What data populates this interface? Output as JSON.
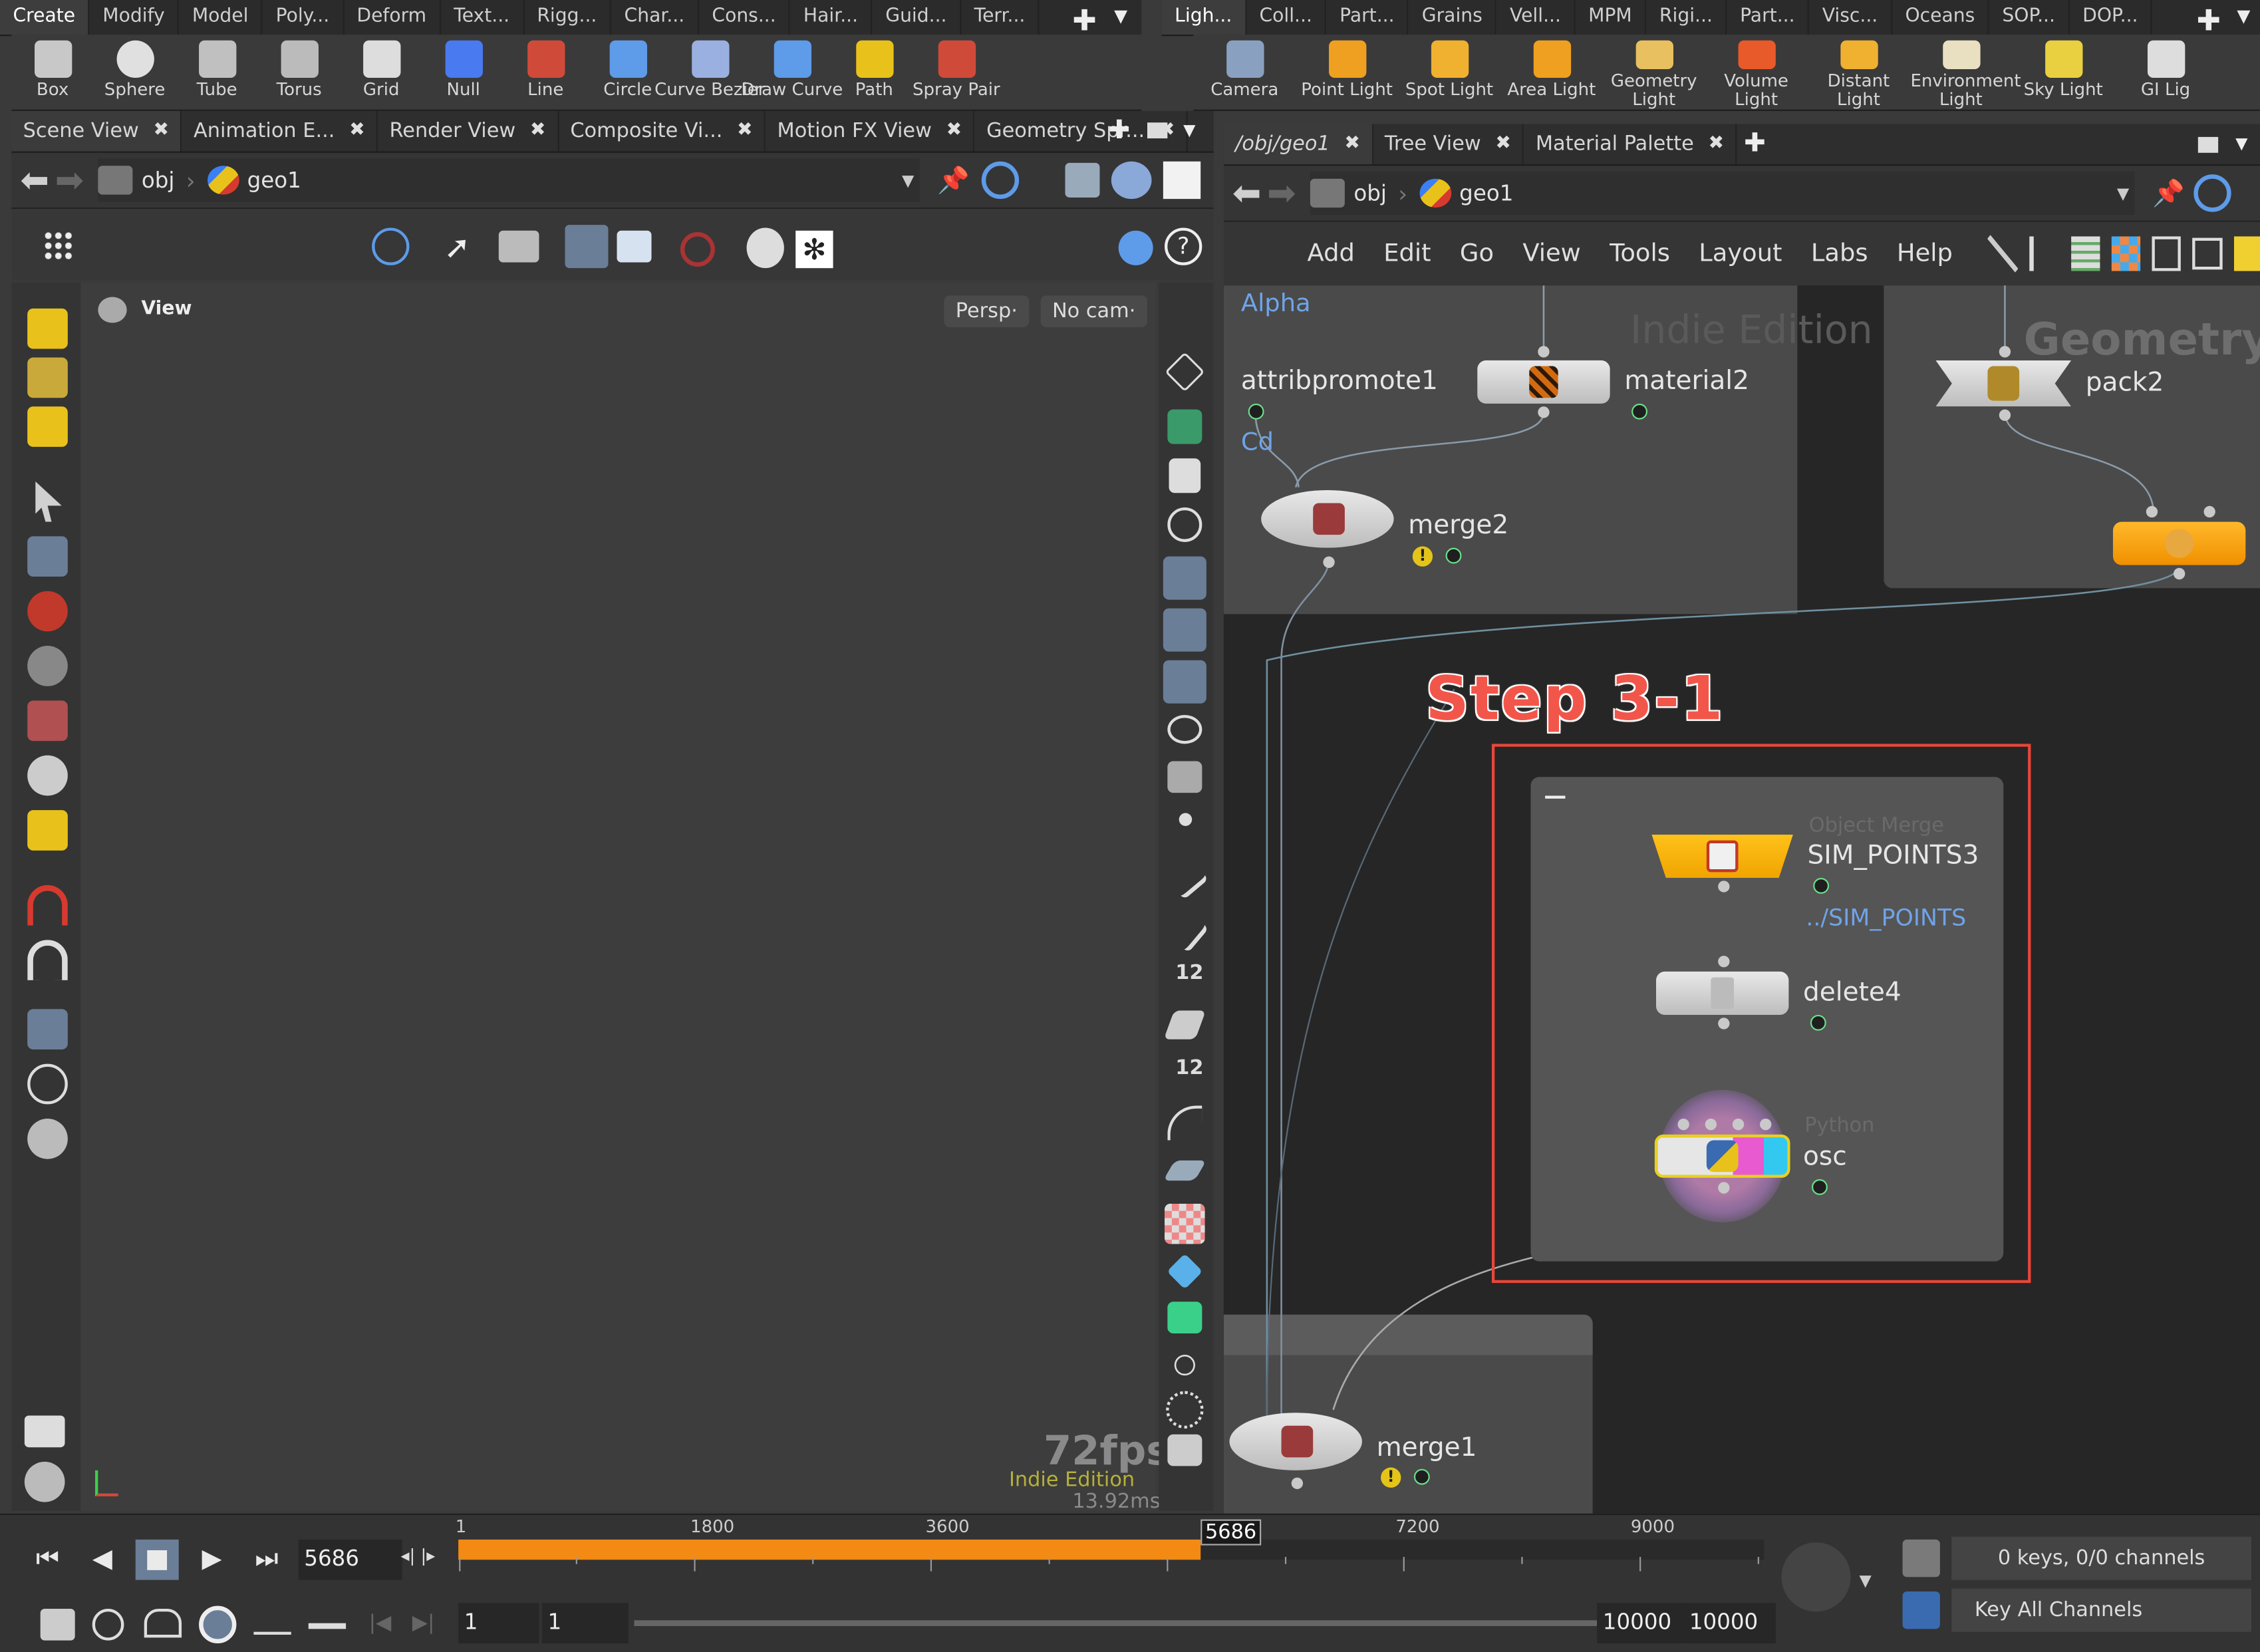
{
  "left_shelf": {
    "tabs": [
      "Create",
      "Modify",
      "Model",
      "Poly...",
      "Deform",
      "Text...",
      "Rigg...",
      "Char...",
      "Cons...",
      "Hair...",
      "Guid...",
      "Terr..."
    ],
    "tools": [
      {
        "label": "Box",
        "icon": "box-icon"
      },
      {
        "label": "Sphere",
        "icon": "sphere-icon"
      },
      {
        "label": "Tube",
        "icon": "tube-icon"
      },
      {
        "label": "Torus",
        "icon": "torus-icon"
      },
      {
        "label": "Grid",
        "icon": "grid-icon"
      },
      {
        "label": "Null",
        "icon": "null-icon"
      },
      {
        "label": "Line",
        "icon": "line-icon"
      },
      {
        "label": "Circle",
        "icon": "circle-icon"
      },
      {
        "label": "Curve Bezier",
        "icon": "curve-bezier-icon"
      },
      {
        "label": "Draw Curve",
        "icon": "draw-curve-icon"
      },
      {
        "label": "Path",
        "icon": "path-icon"
      },
      {
        "label": "Spray Pair",
        "icon": "spray-paint-icon"
      }
    ]
  },
  "right_shelf": {
    "tabs": [
      "Ligh...",
      "Coll...",
      "Part...",
      "Grains",
      "Vell...",
      "MPM",
      "Rigi...",
      "Part...",
      "Visc...",
      "Oceans",
      "SOP...",
      "DOP..."
    ],
    "tools": [
      {
        "label": "Camera",
        "icon": "camera-icon"
      },
      {
        "label": "Point Light",
        "icon": "point-light-icon"
      },
      {
        "label": "Spot Light",
        "icon": "spot-light-icon"
      },
      {
        "label": "Area Light",
        "icon": "area-light-icon"
      },
      {
        "label": "Geometry Light",
        "icon": "geometry-light-icon"
      },
      {
        "label": "Volume Light",
        "icon": "volume-light-icon"
      },
      {
        "label": "Distant Light",
        "icon": "distant-light-icon"
      },
      {
        "label": "Environment Light",
        "icon": "environment-light-icon"
      },
      {
        "label": "Sky Light",
        "icon": "sky-light-icon"
      },
      {
        "label": "GI Lig",
        "icon": "gi-light-icon"
      }
    ]
  },
  "left_pane": {
    "tabs": [
      "Scene View",
      "Animation E...",
      "Render View",
      "Composite Vi...",
      "Motion FX View",
      "Geometry Spr..."
    ],
    "path": {
      "root": "obj",
      "node": "geo1"
    },
    "viewport": {
      "label": "View",
      "persp": "Persp",
      "cam": "No cam",
      "fps": "72fps",
      "edition": "Indie Edition",
      "ms": "13.92ms"
    }
  },
  "right_pane": {
    "tabs": [
      "/obj/geo1",
      "Tree View",
      "Material Palette"
    ],
    "path": {
      "root": "obj",
      "node": "geo1"
    },
    "menu": [
      "Add",
      "Edit",
      "Go",
      "View",
      "Tools",
      "Layout",
      "Labs",
      "Help"
    ],
    "network": {
      "alpha_label": "Alpha",
      "cd_label": "Cd",
      "edition_watermark": "Indie Edition",
      "geometry_watermark": "Geometry",
      "step_label": "Step 3-1",
      "nodes": {
        "attribpromote": "attribpromote1",
        "material": "material2",
        "pack": "pack2",
        "merge2": "merge2",
        "object_merge_type": "Object Merge",
        "sim_points": "SIM_POINTS3",
        "sim_points_path": "../SIM_POINTS",
        "delete": "delete4",
        "python_type": "Python",
        "osc": "osc",
        "merge1": "merge1"
      }
    }
  },
  "timeline": {
    "current_frame": "5686",
    "ticks": [
      "1",
      "1800",
      "3600",
      "5686",
      "7200",
      "9000"
    ],
    "progress": 0.5686,
    "start": "1",
    "start2": "1",
    "end": "10000",
    "end2": "10000",
    "keys": "0 keys, 0/0 channels",
    "key_all": "Key All Channels"
  },
  "colors": {
    "accent": "#f28a14",
    "node_yellow": "#f5b400",
    "step_red": "#e8463a",
    "python_magenta": "#e85ad0",
    "python_cyan": "#33c8f0"
  }
}
